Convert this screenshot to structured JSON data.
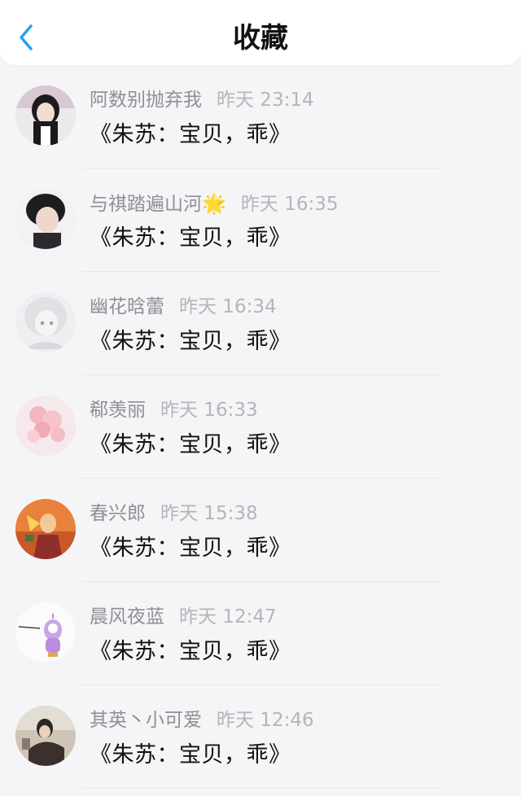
{
  "header": {
    "title": "收藏",
    "back_icon": "chevron-left-icon",
    "accent": "#2aa1f0"
  },
  "favorites": [
    {
      "author": "阿数别抛弃我",
      "time": "昨天 23:14",
      "content": "《朱苏：宝贝，乖》"
    },
    {
      "author": "与祺踏遍山河",
      "emoji": "🌟",
      "time": "昨天 16:35",
      "content": "《朱苏：宝贝，乖》"
    },
    {
      "author": "幽花晗蕾",
      "time": "昨天 16:34",
      "content": "《朱苏：宝贝，乖》"
    },
    {
      "author": "郗羡丽",
      "time": "昨天 16:33",
      "content": "《朱苏：宝贝，乖》"
    },
    {
      "author": "春兴郎",
      "time": "昨天 15:38",
      "content": "《朱苏：宝贝，乖》"
    },
    {
      "author": "晨风夜蓝",
      "time": "昨天 12:47",
      "content": "《朱苏：宝贝，乖》"
    },
    {
      "author": "其英丶小可爱",
      "time": "昨天 12:46",
      "content": "《朱苏：宝贝，乖》"
    }
  ]
}
